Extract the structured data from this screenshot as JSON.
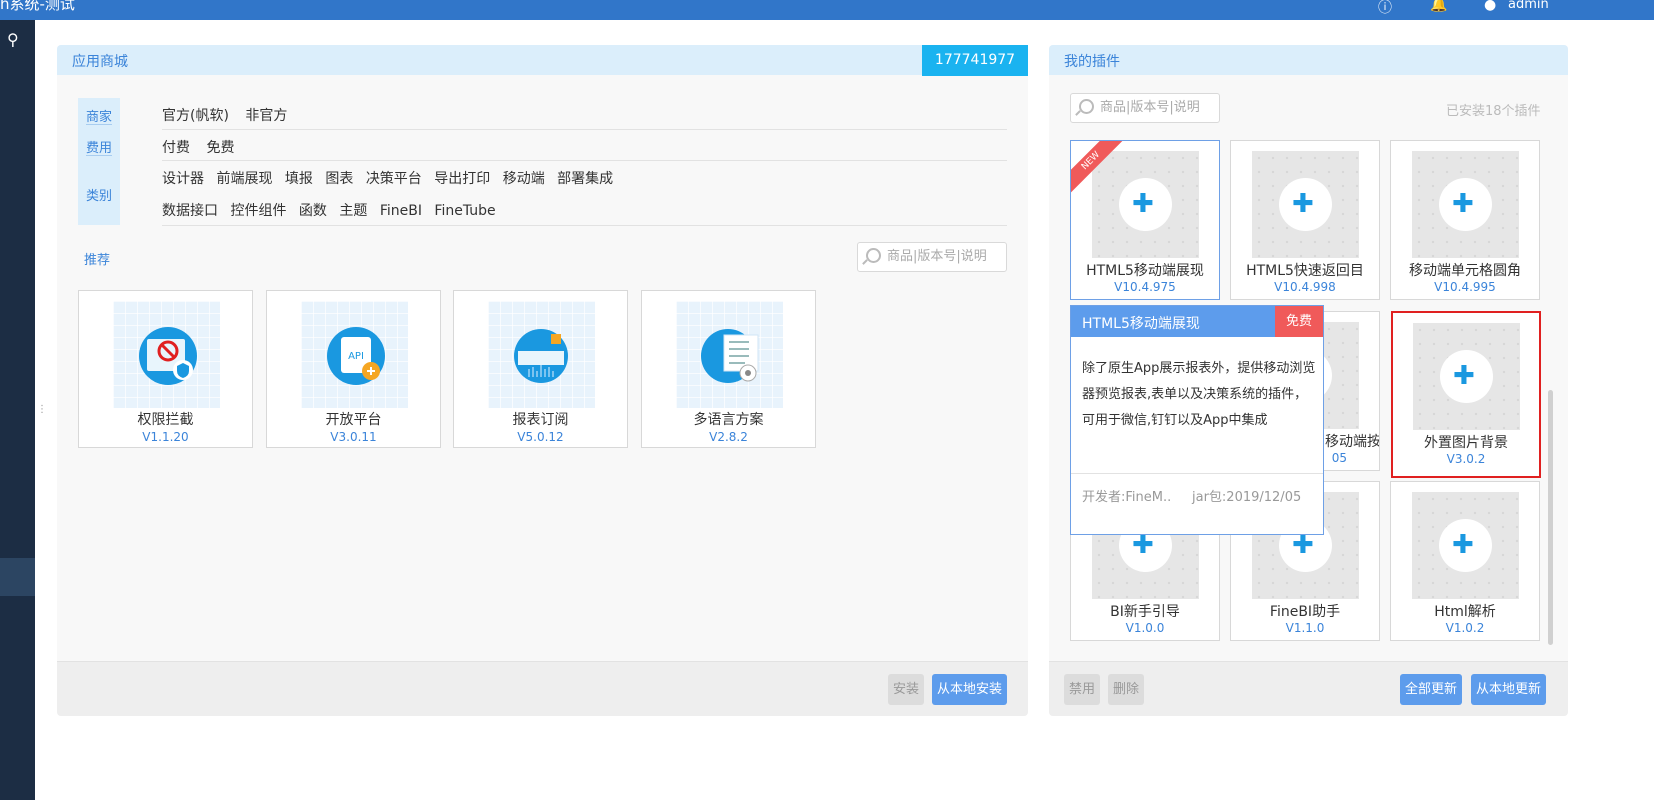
{
  "header": {
    "title": "h系统-测试",
    "user": "admin"
  },
  "store": {
    "title": "应用商城",
    "id_badge": "177741977",
    "filters": {
      "labels": [
        "商家",
        "费用",
        "类别"
      ],
      "vendor_options": [
        "官方(帆软)",
        "非官方"
      ],
      "fee_options": [
        "付费",
        "免费"
      ],
      "category_row1": [
        "设计器",
        "前端展现",
        "填报",
        "图表",
        "决策平台",
        "导出打印",
        "移动端",
        "部署集成"
      ],
      "category_row2": [
        "数据接口",
        "控件组件",
        "函数",
        "主题",
        "FineBI",
        "FineTube"
      ]
    },
    "recommend_label": "推荐",
    "search_placeholder": "商品|版本号|说明",
    "cards": [
      {
        "name": "权限拦截",
        "version": "V1.1.20"
      },
      {
        "name": "开放平台",
        "version": "V3.0.11"
      },
      {
        "name": "报表订阅",
        "version": "V5.0.12"
      },
      {
        "name": "多语言方案",
        "version": "V2.8.2"
      }
    ],
    "buttons": {
      "install": "安装",
      "install_local": "从本地安装"
    }
  },
  "plugins": {
    "title": "我的插件",
    "search_placeholder": "商品|版本号|说明",
    "installed_count": "已安装18个插件",
    "new_badge": "NEW",
    "cards": [
      {
        "name": "HTML5移动端展现",
        "version": "V10.4.975"
      },
      {
        "name": "HTML5快速返回目",
        "version": "V10.4.998"
      },
      {
        "name": "移动端单元格圆角",
        "version": "V10.4.995"
      },
      {
        "name": "移动端按",
        "version": "05"
      },
      {
        "name": "外置图片背景",
        "version": "V3.0.2"
      },
      {
        "name": "BI新手引导",
        "version": "V1.0.0"
      },
      {
        "name": "FineBI助手",
        "version": "V1.1.0"
      },
      {
        "name": "Html解析",
        "version": "V1.0.2"
      }
    ],
    "buttons": {
      "disable": "禁用",
      "delete": "删除",
      "update_all": "全部更新",
      "update_local": "从本地更新"
    }
  },
  "popup": {
    "title": "HTML5移动端展现",
    "badge": "免费",
    "description": "除了原生App展示报表外，提供移动浏览器预览报表,表单以及决策系统的插件，可用于微信,钉钉以及App中集成",
    "developer": "开发者:FineM..",
    "jar": "jar包:2019/12/05"
  },
  "colors": {
    "accent": "#3b84d9",
    "badge": "#1ab3f0",
    "free": "#f05a5a",
    "sidebar": "#1c2d44"
  }
}
